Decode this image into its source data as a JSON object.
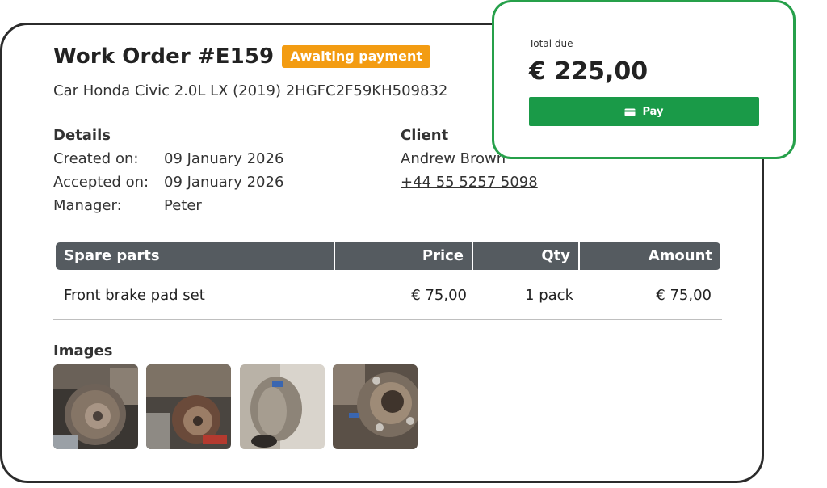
{
  "order": {
    "title": "Work Order #E159",
    "status_badge": "Awaiting payment",
    "car": "Car Honda Civic 2.0L LX (2019) 2HGFC2F59KH509832"
  },
  "details": {
    "heading": "Details",
    "created_label": "Created on:",
    "created_value": "09 January 2026",
    "accepted_label": "Accepted on:",
    "accepted_value": "09 January 2026",
    "manager_label": "Manager:",
    "manager_value": "Peter"
  },
  "client": {
    "heading": "Client",
    "name": "Andrew Brown",
    "phone": "+44 55 5257 5098"
  },
  "parts_table": {
    "headers": [
      "Spare parts",
      "Price",
      "Qty",
      "Amount"
    ],
    "rows": [
      [
        "Front brake pad set",
        "€ 75,00",
        "1 pack",
        "€ 75,00"
      ]
    ]
  },
  "images": {
    "heading": "Images",
    "items": [
      "brake-disc-photo-1",
      "brake-assembly-photo-2",
      "brake-pad-photo-3",
      "wheel-hub-photo-4"
    ]
  },
  "total": {
    "label": "Total due",
    "value": "€ 225,00",
    "pay_label": "Pay",
    "pay_icon": "card-icon"
  },
  "colors": {
    "badge": "#f39c12",
    "pay_button": "#1a9a48",
    "total_border": "#26a04a",
    "table_header": "#555b60"
  }
}
